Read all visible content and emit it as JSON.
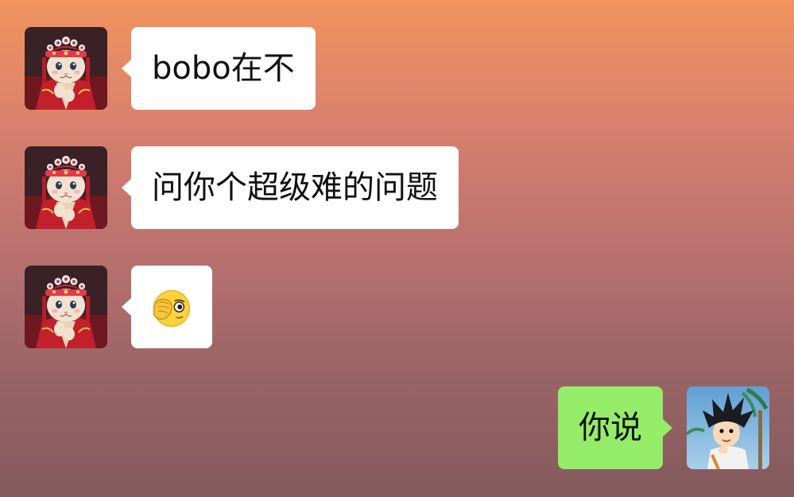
{
  "chat": {
    "messages": [
      {
        "side": "left",
        "text": "bobo在不"
      },
      {
        "side": "left",
        "text": "问你个超级难的问题"
      },
      {
        "side": "left",
        "emoji": "facepalm-peek-emoji"
      },
      {
        "side": "right",
        "text": "你说"
      }
    ]
  },
  "avatars": {
    "friend": "cat-opera-avatar",
    "me": "cartoon-boy-avatar"
  },
  "colors": {
    "incoming_bubble": "#ffffff",
    "outgoing_bubble": "#95ec69"
  }
}
